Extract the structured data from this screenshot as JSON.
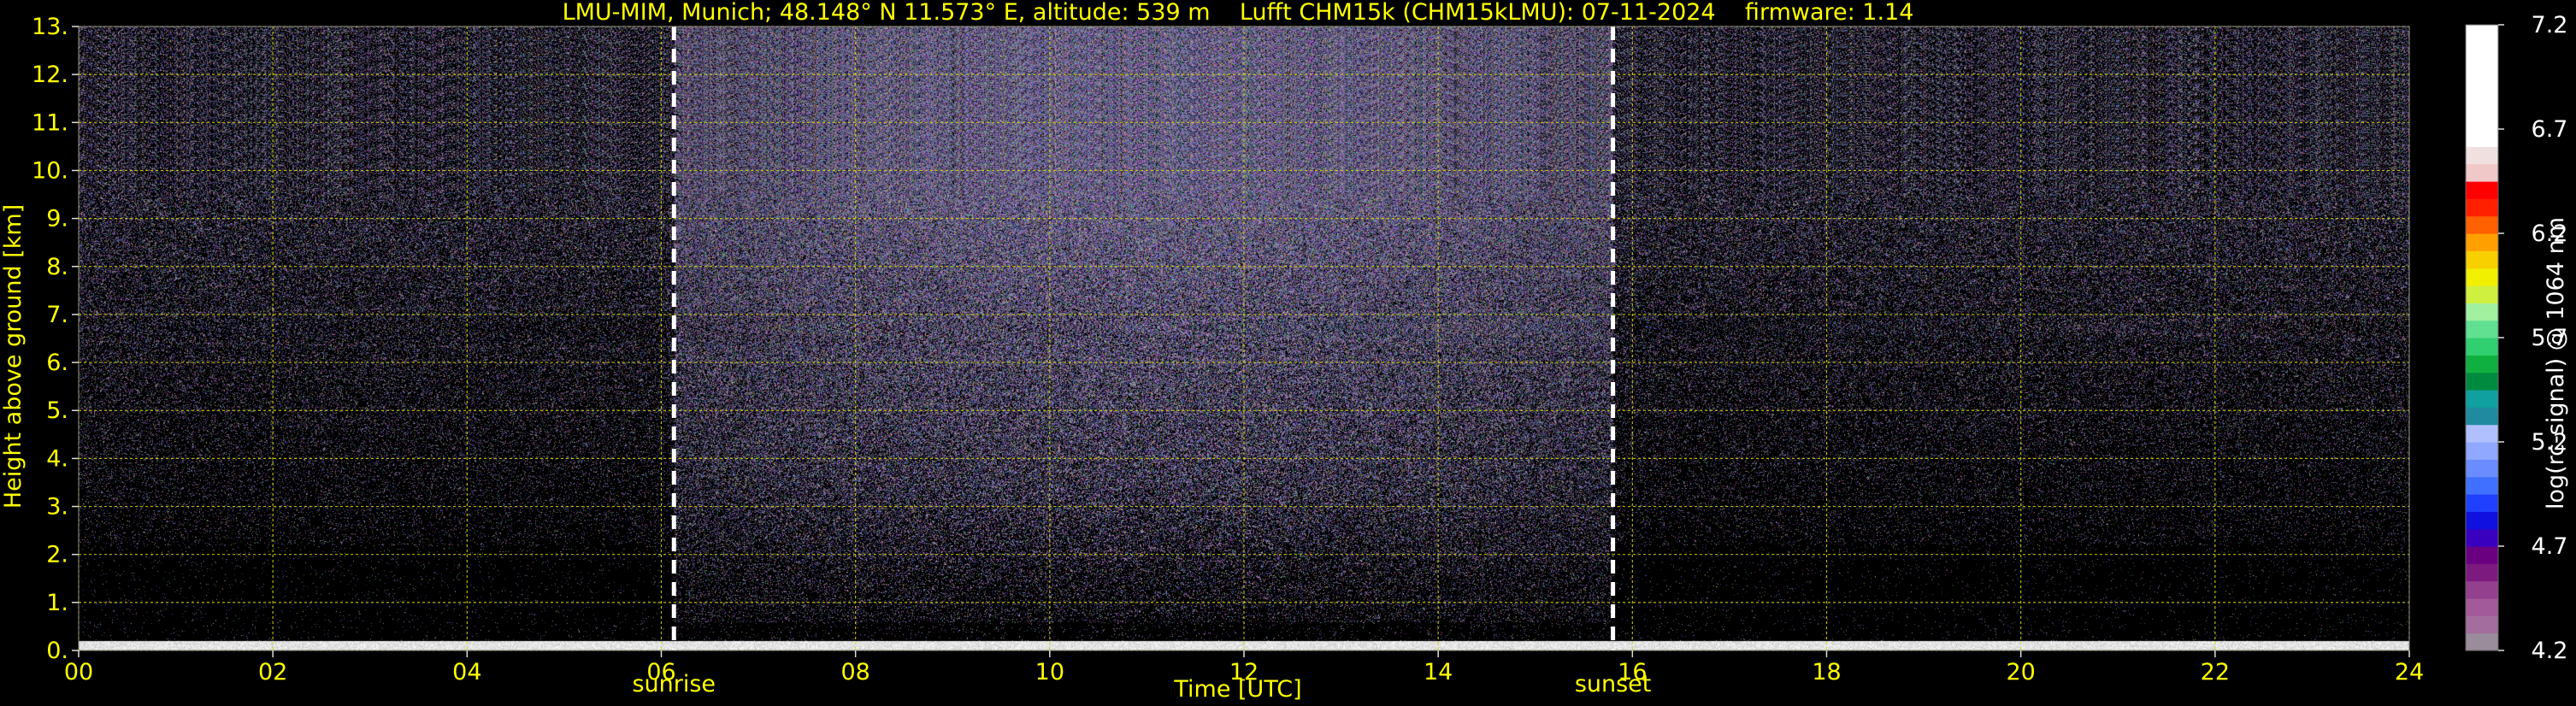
{
  "chart_data": {
    "type": "heatmap",
    "title": "LMU-MIM, Munich; 48.148° N 11.573° E, altitude: 539 m    Lufft CHM15k (CHM15kLMU): 07-11-2024    firmware: 1.14",
    "xlabel": "Time [UTC]",
    "ylabel": "Height above ground [km]",
    "xlim": [
      0,
      24
    ],
    "ylim": [
      0,
      13
    ],
    "x_ticks": [
      "00",
      "02",
      "04",
      "06",
      "08",
      "10",
      "12",
      "14",
      "16",
      "18",
      "20",
      "22",
      "24"
    ],
    "x_tick_values": [
      0,
      2,
      4,
      6,
      8,
      10,
      12,
      14,
      16,
      18,
      20,
      22,
      24
    ],
    "y_ticks": [
      "0.",
      "1.",
      "2.",
      "3.",
      "4.",
      "5.",
      "6.",
      "7.",
      "8.",
      "9.",
      "10.",
      "11.",
      "12.",
      "13."
    ],
    "y_tick_values": [
      0,
      1,
      2,
      3,
      4,
      5,
      6,
      7,
      8,
      9,
      10,
      11,
      12,
      13
    ],
    "grid": true,
    "annotations": [
      {
        "label": "sunrise",
        "time": 6.13
      },
      {
        "label": "sunset",
        "time": 15.8
      }
    ],
    "colorbar": {
      "label": "log(rc-signal) @ 1064 nm",
      "range": [
        4.2,
        7.2
      ],
      "ticks": [
        "4.2",
        "4.7",
        "5.2",
        "5.7",
        "6.2",
        "6.7",
        "7.2"
      ],
      "tick_values": [
        4.2,
        4.7,
        5.2,
        5.7,
        6.2,
        6.7,
        7.2
      ],
      "colors": [
        "#9a8c9a",
        "#a36e9d",
        "#a35a9a",
        "#93408f",
        "#7d1a80",
        "#6a0080",
        "#3a00c0",
        "#1010e0",
        "#2040ff",
        "#4070ff",
        "#6a8cff",
        "#90a8ff",
        "#b0c0ff",
        "#208aa0",
        "#10a0a0",
        "#008a40",
        "#10b040",
        "#30d070",
        "#60e090",
        "#a0f0a0",
        "#d0f040",
        "#f0f000",
        "#f8d000",
        "#ffa000",
        "#ff6000",
        "#ff2000",
        "#ff0000",
        "#f0c8c8",
        "#f0e0e0",
        "#ffffff",
        "#ffffff",
        "#ffffff",
        "#ffffff",
        "#ffffff",
        "#ffffff",
        "#ffffff"
      ]
    },
    "description_of_field": "signal strongest near ground (0-0.2 km), daytime (sunrise to sunset) shows higher noise background up to 13 km; weak aerosol layer below ~2 km"
  },
  "colors": {
    "background": "#000000",
    "text": "#ffff00",
    "grid": "#d8d800",
    "sun_lines": "#ffffff",
    "colorbar_text": "#ffffff"
  }
}
